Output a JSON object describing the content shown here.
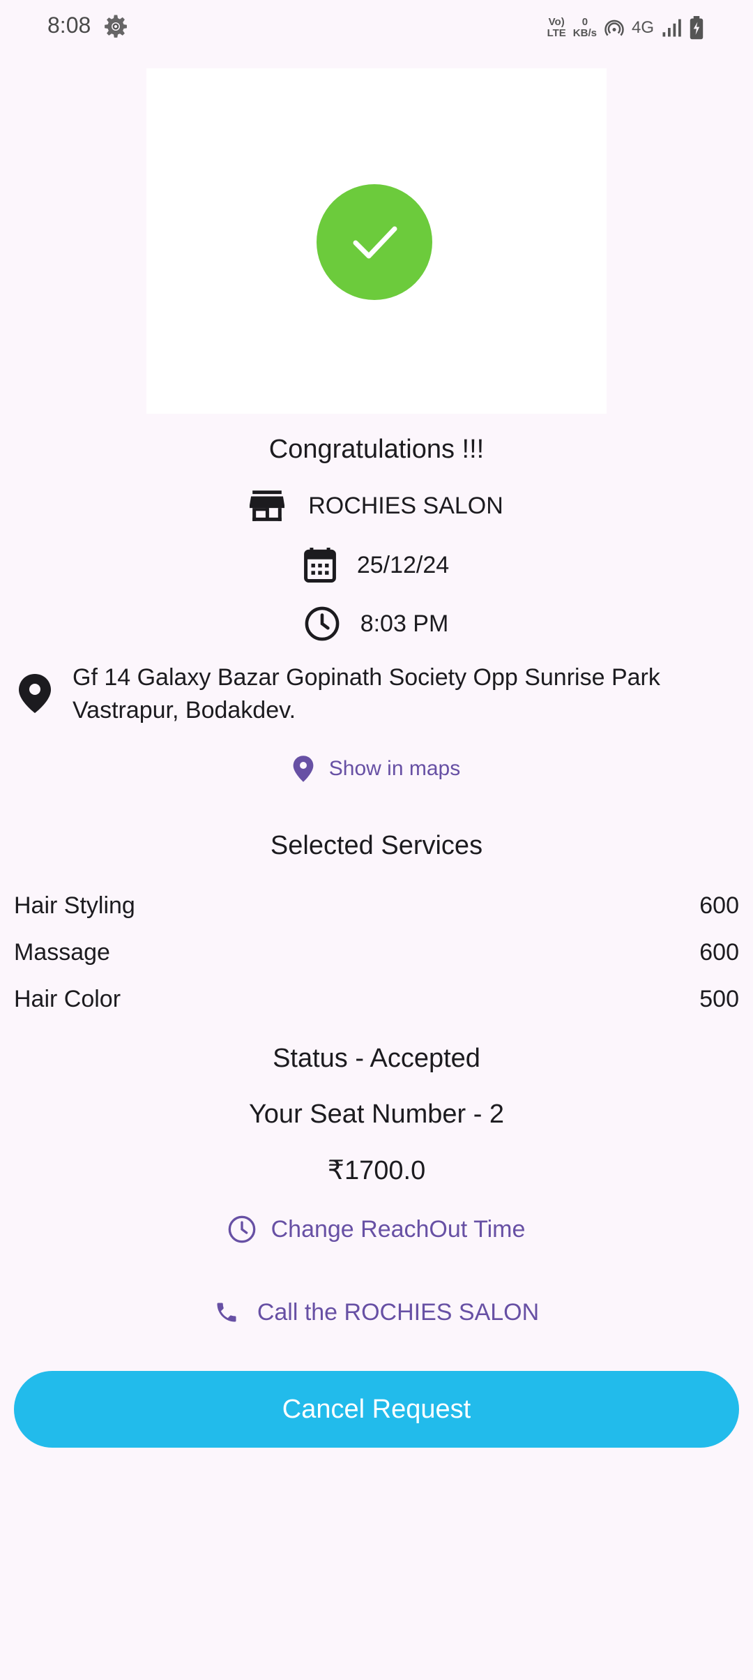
{
  "status_bar": {
    "time": "8:08",
    "volte_top": "Vo)",
    "volte_bottom": "LTE",
    "speed_value": "0",
    "speed_unit": "KB/s",
    "network": "4G"
  },
  "booking": {
    "heading": "Congratulations !!!",
    "salon_name": "ROCHIES SALON",
    "date": "25/12/24",
    "time": "8:03 PM",
    "address": "Gf 14 Galaxy Bazar Gopinath Society Opp Sunrise Park Vastrapur, Bodakdev.",
    "maps_link": "Show in maps"
  },
  "services": {
    "title": "Selected Services",
    "items": [
      {
        "name": "Hair Styling",
        "price": "600"
      },
      {
        "name": "Massage",
        "price": "600"
      },
      {
        "name": "Hair Color",
        "price": "500"
      }
    ]
  },
  "summary": {
    "status": "Status - Accepted",
    "seat": "Your Seat Number - 2",
    "total": "₹1700.0"
  },
  "actions": {
    "change_time": "Change ReachOut Time",
    "call": "Call the ROCHIES SALON",
    "cancel": "Cancel Request"
  },
  "colors": {
    "background": "#FCF6FC",
    "success": "#6CCB3C",
    "accent": "#6750A4",
    "cancel_button": "#22BBEB"
  }
}
